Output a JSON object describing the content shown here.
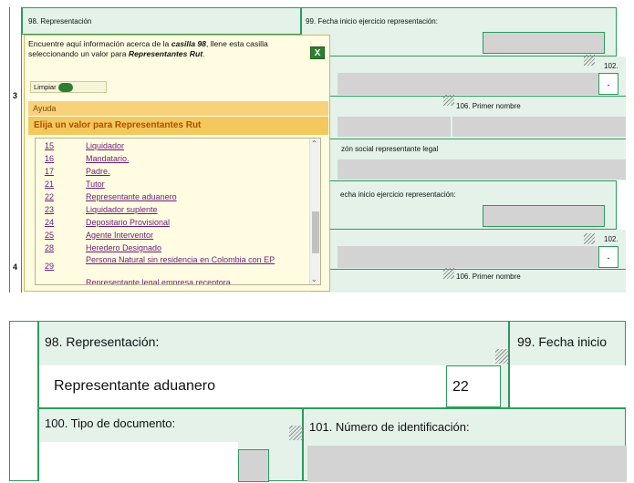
{
  "top": {
    "field98_label": "98. Representación",
    "field99_label_a": "99. Fecha inicio ejercicio representación:",
    "field102_a": "102.",
    "field106_a": "106. Primer nombre",
    "razon_label": "zón social representante legal",
    "field99_label_b": "echa inicio ejercicio representación:",
    "field102_b": "102.",
    "field106_b": "106. Primer nombre",
    "side_num_3": "3",
    "side_num_4": "4",
    "dash_a": "-",
    "dash_b": "-"
  },
  "popup": {
    "info_text_1": "Encuentre aquí información acerca de la ",
    "info_bold_1": "casilla 98",
    "info_text_2": ", llene esta casilla seleccionando un valor para ",
    "info_bold_2": "Representantes Rut",
    "info_text_3": ".",
    "close_label": "X",
    "clear_label": "Limpiar",
    "ayuda_label": "Ayuda",
    "elija_label": "Elija un valor para Representantes Rut",
    "options": [
      {
        "code": "15",
        "desc": "Liquidador"
      },
      {
        "code": "16",
        "desc": "Mandatario."
      },
      {
        "code": "17",
        "desc": "Padre."
      },
      {
        "code": "21",
        "desc": "Tutor"
      },
      {
        "code": "22",
        "desc": "Representante aduanero"
      },
      {
        "code": "23",
        "desc": "Liquidador suplente"
      },
      {
        "code": "24",
        "desc": "Depositario Provisional"
      },
      {
        "code": "25",
        "desc": "Agente Interventor"
      },
      {
        "code": "28",
        "desc": "Heredero Designado"
      },
      {
        "code": "29",
        "desc": "Persona Natural sin residencia en Colombia con EP"
      },
      {
        "code": "",
        "desc": "Representante legal empresa receptora"
      }
    ]
  },
  "bottom": {
    "field98_label": "98. Representación:",
    "field99_label": "99. Fecha inicio",
    "selected_value": "Representante aduanero",
    "selected_code": "22",
    "field100_label": "100. Tipo de documento:",
    "field101_label": "101. Número de identificación:"
  }
}
